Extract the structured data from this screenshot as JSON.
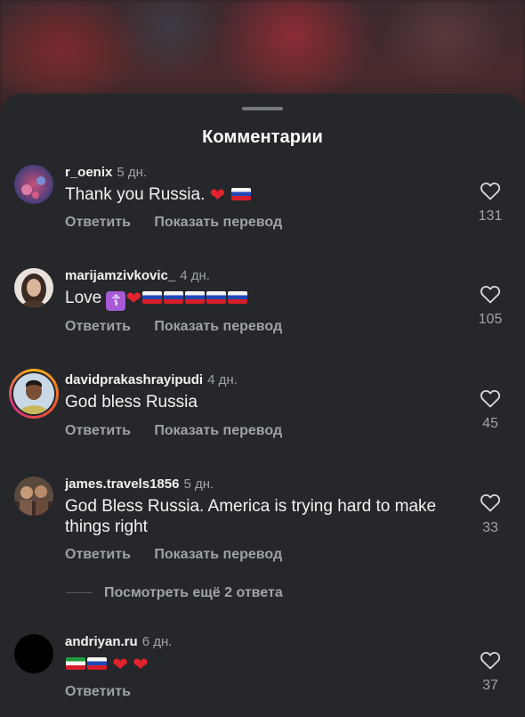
{
  "sheet": {
    "title": "Комментарии"
  },
  "comments": [
    {
      "username": "r_oenix",
      "time": "5 дн.",
      "text": "Thank you Russia.",
      "emoji": [
        "red-heart",
        "flag-russia"
      ],
      "reply_label": "Ответить",
      "translate_label": "Показать перевод",
      "likes": "131"
    },
    {
      "username": "marijamzivkovic_",
      "time": "4 дн.",
      "text": "Love",
      "emoji": [
        "orthodox-cross",
        "red-heart",
        "flag-russia",
        "flag-russia",
        "flag-russia",
        "flag-russia",
        "flag-russia"
      ],
      "reply_label": "Ответить",
      "translate_label": "Показать перевод",
      "likes": "105"
    },
    {
      "username": "davidprakashrayipudi",
      "time": "4 дн.",
      "text": "God bless Russia",
      "reply_label": "Ответить",
      "translate_label": "Показать перевод",
      "likes": "45"
    },
    {
      "username": "james.travels1856",
      "time": "5 дн.",
      "text": "God Bless Russia.  America is trying hard to make things right",
      "reply_label": "Ответить",
      "translate_label": "Показать перевод",
      "likes": "33"
    },
    {
      "username": "andriyan.ru",
      "time": "6 дн.",
      "text": "",
      "emoji": [
        "flag-iran",
        "flag-russia",
        "red-heart",
        "red-heart"
      ],
      "reply_label": "Ответить",
      "likes": "37"
    }
  ],
  "more_replies_label": "Посмотреть ещё 2 ответа",
  "glyphs": {
    "heart": "❤",
    "cross": "☦"
  },
  "colors": {
    "sheet_bg": "#25272a",
    "text_primary": "#f2f2f2",
    "text_secondary": "#a0a3a8"
  }
}
